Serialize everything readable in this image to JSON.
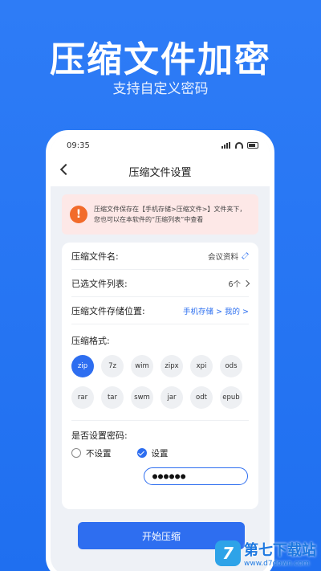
{
  "hero": {
    "title": "压缩文件加密",
    "subtitle": "支持自定义密码"
  },
  "status": {
    "time": "09:35"
  },
  "nav": {
    "title": "压缩文件设置"
  },
  "notice": {
    "line1": "压缩文件保存在【手机存储>压缩文件>】文件夹下，",
    "line2": "您也可以在本软件的“压缩列表”中查看"
  },
  "form": {
    "name_label": "压缩文件名:",
    "name_value": "会议资料",
    "files_label": "已选文件列表:",
    "files_value": "6个",
    "location_label": "压缩文件存储位置:",
    "location_value": "手机存储 > 我的 >",
    "format_label": "压缩格式:",
    "formats": [
      "zip",
      "7z",
      "wim",
      "zipx",
      "xpi",
      "ods",
      "rar",
      "tar",
      "swm",
      "jar",
      "odt",
      "epub"
    ],
    "selected_format": "zip",
    "password_label": "是否设置密码:",
    "option_no": "不设置",
    "option_yes": "设置",
    "password_value": "●●●●●●"
  },
  "actions": {
    "start_label": "开始压缩"
  },
  "watermark": {
    "name": "第七下载站",
    "url": "www.d7down.com"
  },
  "colors": {
    "accent": "#2e6ef0",
    "background": "#1f6ff0",
    "notice_bg": "#fde8e7",
    "warning": "#f26b2a"
  }
}
